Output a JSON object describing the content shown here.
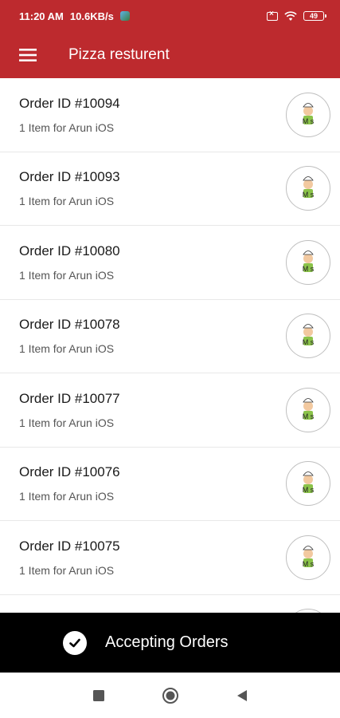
{
  "status_bar": {
    "time": "11:20 AM",
    "speed": "10.6KB/s",
    "battery": "49"
  },
  "app_bar": {
    "title": "Pizza resturent"
  },
  "orders": [
    {
      "id": "Order ID #10094",
      "summary": "1 Item for Arun iOS"
    },
    {
      "id": "Order ID #10093",
      "summary": "1 Item for Arun iOS"
    },
    {
      "id": "Order ID #10080",
      "summary": "1 Item for Arun iOS"
    },
    {
      "id": "Order ID #10078",
      "summary": "1 Item for Arun iOS"
    },
    {
      "id": "Order ID #10077",
      "summary": "1 Item for Arun iOS"
    },
    {
      "id": "Order ID #10076",
      "summary": "1 Item for Arun iOS"
    },
    {
      "id": "Order ID #10075",
      "summary": "1 Item for Arun iOS"
    }
  ],
  "accept_bar": {
    "label": "Accepting Orders"
  },
  "colors": {
    "brand": "#bd2a2e",
    "accept_bar": "#000000"
  },
  "icons": {
    "menu": "hamburger-icon",
    "avatar": "chef-avatar-icon",
    "check": "check-circle-icon",
    "nav": [
      "square-recents-icon",
      "circle-home-icon",
      "triangle-back-icon"
    ]
  }
}
